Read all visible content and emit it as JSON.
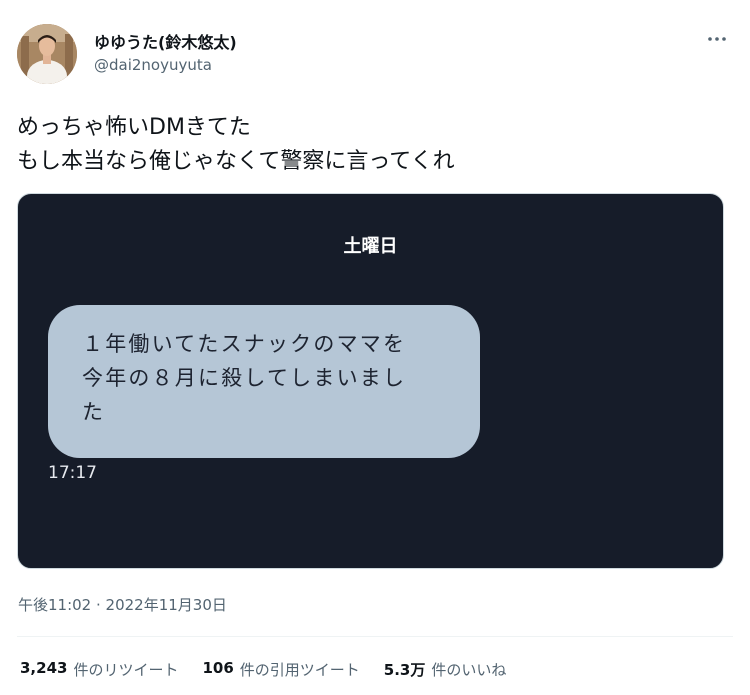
{
  "author": {
    "display_name": "ゆゆうた(鈴木悠太)",
    "handle": "@dai2noyuyuta"
  },
  "tweet": {
    "lines": [
      "めっちゃ怖いDMきてた",
      "もし本当なら俺じゃなくて警察に言ってくれ"
    ]
  },
  "media": {
    "day_label": "土曜日",
    "message_lines": [
      "１年働いてたスナックのママを",
      "今年の８月に殺してしまいまし",
      "た"
    ],
    "message_time": "17:17"
  },
  "timestamp": "午後11:02 · 2022年11月30日",
  "stats": [
    {
      "value": "3,243",
      "label": "件のリツイート"
    },
    {
      "value": "106",
      "label": "件の引用ツイート"
    },
    {
      "value": "5.3万",
      "label": "件のいいね"
    }
  ],
  "icons": {
    "more": "more-horizontal-icon",
    "avatar": "profile-photo"
  },
  "colors": {
    "media_background": "#161c29",
    "bubble": "#b5c6d6",
    "secondary_text": "#536471"
  }
}
